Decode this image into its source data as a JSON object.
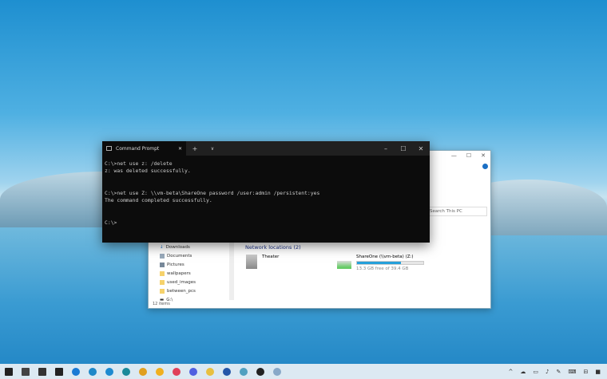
{
  "cmd": {
    "tab_title": "Command Prompt",
    "lines": [
      "C:\\>net use z: /delete",
      "z: was deleted successfully.",
      "",
      "",
      "C:\\>net use Z: \\\\vm-beta\\ShareOne password /user:admin /persistent:yes",
      "The command completed successfully.",
      "",
      "",
      "C:\\>"
    ]
  },
  "explorer": {
    "search_placeholder": "Search This PC",
    "sidebar": [
      "Downloads",
      "Documents",
      "Pictures",
      "wallpapers",
      "used_images",
      "between_pcs",
      "G:\\"
    ],
    "section": "Network locations (2)",
    "items": [
      {
        "name": "Theater"
      },
      {
        "name": "ShareOne (\\\\vm-beta) (Z:)",
        "free": "13.3 GB free of 39.4 GB",
        "used_fraction": 0.66
      }
    ],
    "status": "12 items"
  },
  "taskbar": {
    "icons": [
      "start-icon",
      "task-view-icon",
      "settings-icon",
      "store-icon",
      "phone-icon",
      "edge-icon",
      "edge-beta-icon",
      "edge-dev-icon",
      "chrome-icon",
      "chrome-canary-icon",
      "firefox-icon",
      "firefox-nightly-icon",
      "file-explorer-icon",
      "powershell-icon",
      "notepad-icon",
      "terminal-icon",
      "remote-desktop-icon"
    ],
    "colors": [
      "#222",
      "#444",
      "#333",
      "#222",
      "#1a7ad4",
      "#1e88c8",
      "#1e8ad0",
      "#1a8a9a",
      "#e0a020",
      "#f0b020",
      "#e0405a",
      "#5060e0",
      "#e8c040",
      "#2456a8",
      "#50a0c0",
      "#222",
      "#88a8c8"
    ]
  }
}
